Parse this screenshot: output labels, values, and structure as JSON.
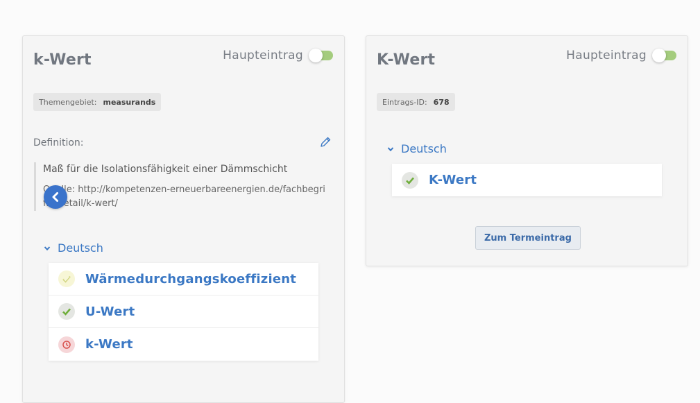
{
  "left_card": {
    "title": "k-Wert",
    "main_entry_label": "Haupteintrag",
    "tag": {
      "label": "Themengebiet:",
      "value": "measurands"
    },
    "definition_label": "Definition:",
    "definition_text": "Maß für die Isolationsfähigkeit einer Dämmschicht",
    "definition_source": "Quelle: http://kompetenzen-erneuerbareenergien.de/fachbegriffe/detail/k-wert/",
    "language": "Deutsch",
    "terms": [
      {
        "name": "Wärmedurchgangskoeffizient",
        "status": "pending",
        "icon": "check-outline-icon"
      },
      {
        "name": "U-Wert",
        "status": "done",
        "icon": "check-icon"
      },
      {
        "name": "k-Wert",
        "status": "rejected",
        "icon": "clock-icon"
      }
    ]
  },
  "right_card": {
    "title": "K-Wert",
    "main_entry_label": "Haupteintrag",
    "tag": {
      "label": "Eintrags-ID:",
      "value": "678"
    },
    "language": "Deutsch",
    "terms": [
      {
        "name": "K-Wert",
        "status": "done",
        "icon": "check-icon"
      }
    ],
    "action_button": "Zum Termeintrag"
  },
  "colors": {
    "accent": "#3b78c4",
    "toggle_on": "#a4cc7d",
    "check_green": "#6fae3b",
    "alert_red": "#d9534f",
    "pending_yellow": "#d6d98a"
  }
}
